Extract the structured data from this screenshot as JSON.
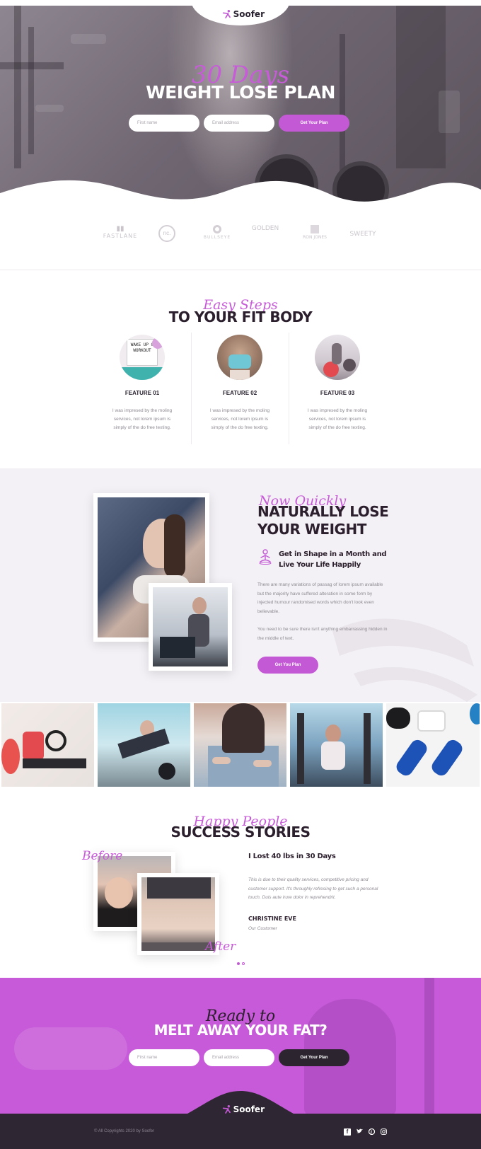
{
  "brand": {
    "name": "Soofer"
  },
  "hero": {
    "script_title": "30 Days",
    "title": "WEIGHT LOSE PLAN",
    "first_name_placeholder": "First name",
    "email_placeholder": "Email address",
    "cta_label": "Get Your Plan"
  },
  "partners": [
    "FASTLANE",
    "nc.",
    "BULLSEYE",
    "GOLDEN",
    "RON JONES",
    "SWEETY"
  ],
  "steps": {
    "script_title": "Easy Steps",
    "title": "TO YOUR FIT BODY",
    "features": [
      {
        "title": "FEATURE 01",
        "text": "I was impresed by the moling services, not lorem ipsum is simply of the do free texting.",
        "image_sign": "WAKE UP & WORKOUT"
      },
      {
        "title": "FEATURE 02",
        "text": "I was impresed by the moling services, not lorem ipsum is simply of the do free texting."
      },
      {
        "title": "FEATURE 03",
        "text": "I was impresed by the moling services, not lorem ipsum is simply of the do free texting."
      }
    ]
  },
  "weight": {
    "script_title": "Now Quickly",
    "title_line1": "NATURALLY LOSE",
    "title_line2": "YOUR WEIGHT",
    "subtitle": "Get in Shape in a Month and Live Your Life Happily",
    "paragraph1": "There are many variations of passag of lorem ipsum available but the majority have suffered alteration in some form by injected humour randomised words which don't look even believable.",
    "paragraph2": "You need to be sure there isn't anything embarrassing hidden in the middle of text.",
    "cta_label": "Get You Plan"
  },
  "stories": {
    "script_title": "Happy People",
    "title": "SUCCESS STORIES",
    "before_label": "Before",
    "after_label": "After",
    "headline": "I Lost 40 lbs in 30 Days",
    "quote": "This is due to their quality services, competitive pricing and customer support. It's throughly refresing to get such a personal touch. Duis aute irure dolor in reprehendrit.",
    "author": "CHRISTINE EVE",
    "role": "Our Customer"
  },
  "cta": {
    "script_title": "Ready to",
    "title": "MELT AWAY YOUR FAT?",
    "first_name_placeholder": "First name",
    "email_placeholder": "Email address",
    "cta_label": "Get Your Plan"
  },
  "footer": {
    "copyright": "© All Copyrights 2020 by Soofer",
    "social_icons": [
      "facebook-icon",
      "twitter-icon",
      "pinterest-icon",
      "instagram-icon"
    ]
  },
  "colors": {
    "accent": "#c459d6",
    "dark": "#2c2530"
  }
}
